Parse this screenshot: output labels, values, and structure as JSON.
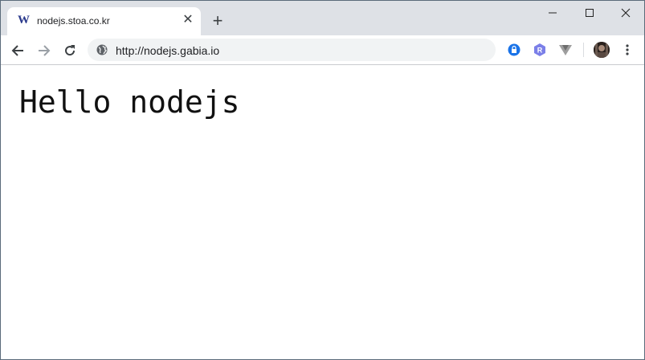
{
  "tab": {
    "title": "nodejs.stoa.co.kr",
    "favicon_letter": "W",
    "close_glyph": "✕"
  },
  "new_tab_glyph": "+",
  "address_bar": {
    "url": "http://nodejs.gabia.io"
  },
  "page": {
    "heading": "Hello nodejs"
  },
  "colors": {
    "tabstrip": "#dee1e6",
    "omnibox": "#f1f3f4",
    "ext_lock": "#1a73e8",
    "ext_r": "#7b7fe8"
  }
}
